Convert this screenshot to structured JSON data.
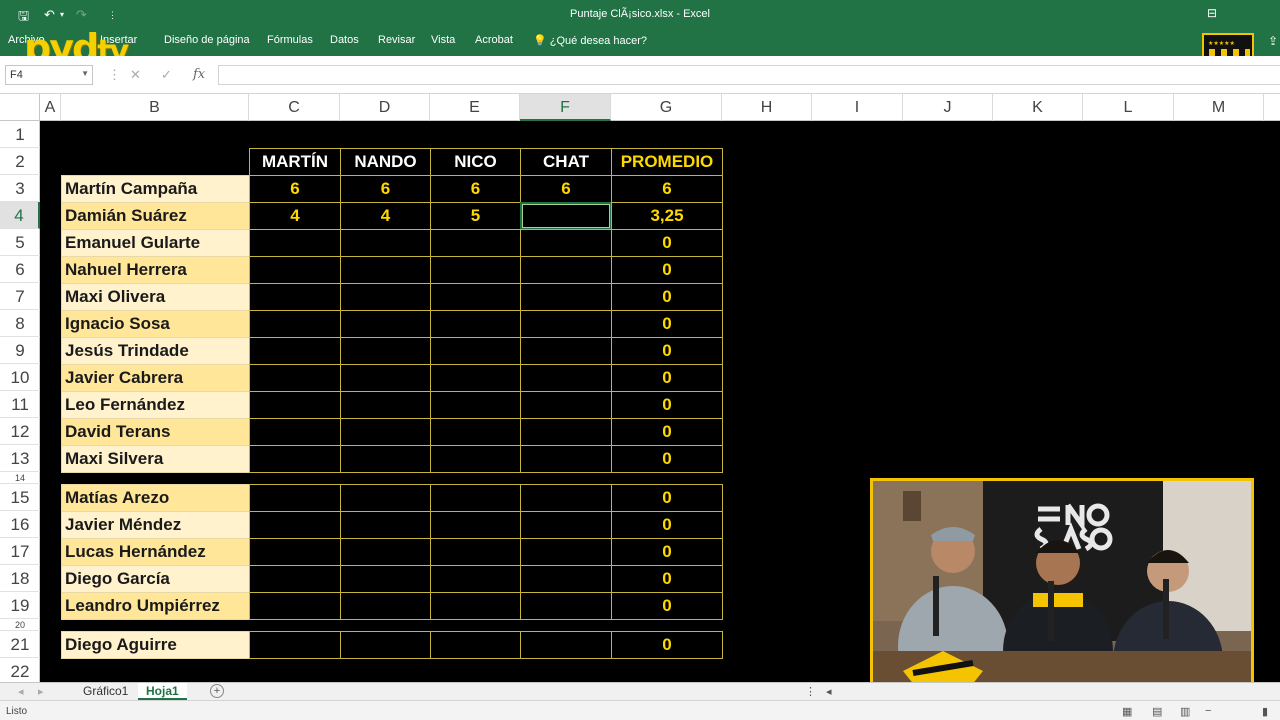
{
  "window": {
    "title": "Puntaje ClÃ¡sico.xlsx - Excel"
  },
  "ribbon": {
    "tabs": [
      "Archivo",
      "Insertar",
      "Diseño de página",
      "Fórmulas",
      "Datos",
      "Revisar",
      "Vista",
      "Acrobat"
    ],
    "tell_me": "¿Qué desea hacer?"
  },
  "logo": {
    "text": "pyd",
    "tv": "tv"
  },
  "formula_bar": {
    "name_box": "F4",
    "value": ""
  },
  "columns": [
    "A",
    "B",
    "C",
    "D",
    "E",
    "F",
    "G",
    "H",
    "I",
    "J",
    "K",
    "L",
    "M"
  ],
  "selected_column": "F",
  "rows": [
    "1",
    "2",
    "3",
    "4",
    "5",
    "6",
    "7",
    "8",
    "9",
    "10",
    "11",
    "12",
    "13",
    "14",
    "15",
    "16",
    "17",
    "18",
    "19",
    "20",
    "21",
    "22"
  ],
  "selected_row": "4",
  "table": {
    "headers": [
      "MARTÍN",
      "NANDO",
      "NICO",
      "CHAT",
      "PROMEDIO"
    ],
    "players": [
      {
        "name": "Martín Campaña",
        "scores": [
          "6",
          "6",
          "6",
          "6"
        ],
        "avg": "6"
      },
      {
        "name": "Damián Suárez",
        "scores": [
          "4",
          "4",
          "5",
          ""
        ],
        "avg": "3,25"
      },
      {
        "name": "Emanuel Gularte",
        "scores": [
          "",
          "",
          "",
          ""
        ],
        "avg": "0"
      },
      {
        "name": "Nahuel Herrera",
        "scores": [
          "",
          "",
          "",
          ""
        ],
        "avg": "0"
      },
      {
        "name": "Maxi Olivera",
        "scores": [
          "",
          "",
          "",
          ""
        ],
        "avg": "0"
      },
      {
        "name": "Ignacio Sosa",
        "scores": [
          "",
          "",
          "",
          ""
        ],
        "avg": "0"
      },
      {
        "name": "Jesús Trindade",
        "scores": [
          "",
          "",
          "",
          ""
        ],
        "avg": "0"
      },
      {
        "name": "Javier Cabrera",
        "scores": [
          "",
          "",
          "",
          ""
        ],
        "avg": "0"
      },
      {
        "name": "Leo Fernández",
        "scores": [
          "",
          "",
          "",
          ""
        ],
        "avg": "0"
      },
      {
        "name": "David Terans",
        "scores": [
          "",
          "",
          "",
          ""
        ],
        "avg": "0"
      },
      {
        "name": "Maxi Silvera",
        "scores": [
          "",
          "",
          "",
          ""
        ],
        "avg": "0"
      },
      {
        "name": "Matías Arezo",
        "scores": [
          "",
          "",
          "",
          ""
        ],
        "avg": "0"
      },
      {
        "name": "Javier Méndez",
        "scores": [
          "",
          "",
          "",
          ""
        ],
        "avg": "0"
      },
      {
        "name": "Lucas Hernández",
        "scores": [
          "",
          "",
          "",
          ""
        ],
        "avg": "0"
      },
      {
        "name": "Diego García",
        "scores": [
          "",
          "",
          "",
          ""
        ],
        "avg": "0"
      },
      {
        "name": "Leandro Umpiérrez",
        "scores": [
          "",
          "",
          "",
          ""
        ],
        "avg": "0"
      },
      {
        "name": "Diego Aguirre",
        "scores": [
          "",
          "",
          "",
          ""
        ],
        "avg": "0"
      }
    ]
  },
  "sheet_tabs": [
    "Gráfico1",
    "Hoja1"
  ],
  "active_sheet": "Hoja1",
  "status": "Listo",
  "colors": {
    "excel_green": "#217346",
    "accent_yellow": "#ffd800",
    "name_fill": "#fff2cc"
  }
}
